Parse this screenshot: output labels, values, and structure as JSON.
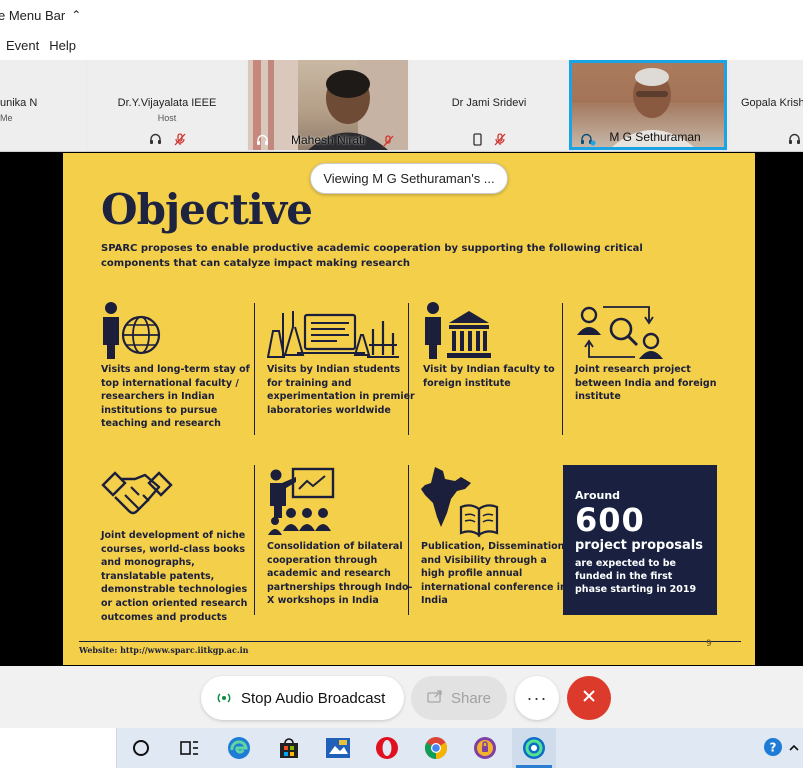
{
  "window": {
    "menubar_toggle_label": "e Menu Bar",
    "menu": [
      "Event",
      "Help"
    ]
  },
  "participants": [
    {
      "name": "unika N",
      "role": "Me"
    },
    {
      "name": "Dr.Y.Vijayalata IEEE",
      "role": "Host"
    },
    {
      "name": "Mahesh Nirati",
      "role": ""
    },
    {
      "name": "Dr Jami Sridevi",
      "role": ""
    },
    {
      "name": "M G Sethuraman",
      "role": ""
    },
    {
      "name": "Gopala Krish",
      "role": ""
    }
  ],
  "viewing_banner": "Viewing M G Sethuraman's ...",
  "slide": {
    "title": "Objective",
    "intro": "SPARC proposes to enable productive academic cooperation by supporting the following critical components that can catalyze impact making research",
    "items": [
      {
        "text": "Visits and long-term stay of top international faculty / researchers in Indian institutions to pursue teaching and research",
        "icon": "faculty-globe-icon"
      },
      {
        "text": "Visits by Indian students for training and experimentation in premier laboratories worldwide",
        "icon": "laboratory-icon"
      },
      {
        "text": "Visit by Indian faculty to foreign institute",
        "icon": "faculty-institute-icon"
      },
      {
        "text": "Joint research project between India and foreign institute",
        "icon": "joint-research-icon"
      },
      {
        "text": "Joint development of niche courses, world-class books and monographs, translatable patents, demonstrable technologies or action oriented research outcomes and products",
        "icon": "handshake-icon"
      },
      {
        "text": "Consolidation of bilateral cooperation through academic and research partnerships through Indo-X workshops in India",
        "icon": "workshop-icon"
      },
      {
        "text": "Publication, Dissemination and Visibility through a high profile annual international conference in India",
        "icon": "india-map-book-icon"
      }
    ],
    "highlight": {
      "around": "Around",
      "number": "600",
      "headline": "project proposals",
      "description": "are expected to be funded in the first phase starting in 2019"
    },
    "website": "Website: http://www.sparc.iitkgp.ac.in",
    "page_number": "9"
  },
  "controls": {
    "stop_audio": "Stop Audio Broadcast",
    "share": "Share",
    "more": "···"
  },
  "colors": {
    "slide_bg": "#f4cf4a",
    "navy": "#1b1f3b",
    "leave_red": "#dc3a2b",
    "active_speaker": "#1aa4e4"
  },
  "taskbar": {
    "icons": [
      "task-view-icon",
      "taskview-timeline-icon",
      "edge-icon",
      "store-icon",
      "app-icon",
      "opera-icon",
      "chrome-icon",
      "vpn-icon",
      "webex-icon",
      "help-icon"
    ]
  }
}
